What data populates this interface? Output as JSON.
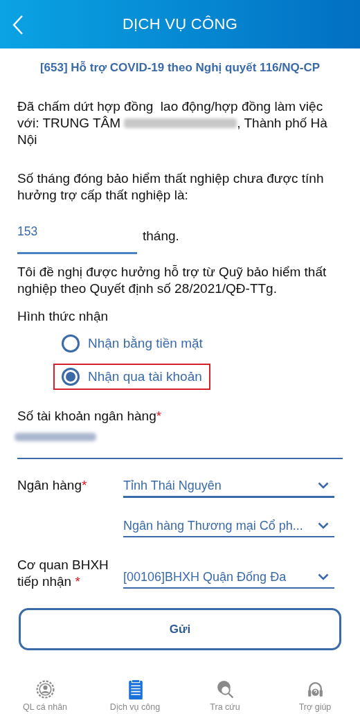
{
  "header": {
    "title": "DỊCH VỤ CÔNG"
  },
  "form_title": "[653] Hỗ trợ COVID-19 theo Nghị quyết 116/NQ-CP",
  "employer_statement": {
    "before": "Đã chấm dứt hợp đồng  lao động/hợp đồng làm việc với: TRUNG TÂM",
    "after": ", Thành phố Hà Nội"
  },
  "months_question": "Số tháng đóng bảo hiểm thất nghiệp chưa được tính hưởng trợ cấp thất nghiệp là:",
  "months_field": {
    "value": "153",
    "unit": "tháng."
  },
  "request_statement": "Tôi đề nghị được hưởng hỗ trợ từ Quỹ bảo hiểm thất nghiệp theo Quyết định số 28/2021/QĐ-TTg.",
  "receive_method": {
    "label": "Hình thức nhận",
    "options": [
      {
        "label": "Nhận bằng tiền mặt",
        "selected": false,
        "highlighted": false
      },
      {
        "label": "Nhận qua tài khoản",
        "selected": true,
        "highlighted": true
      }
    ]
  },
  "account_number": {
    "label": "Số tài khoản ngân hàng",
    "required_mark": "*"
  },
  "bank": {
    "label": "Ngân hàng",
    "required_mark": "*",
    "selects": [
      {
        "value": "Tỉnh Thái Nguyên"
      },
      {
        "value": "Ngân hàng Thương mại Cổ ph..."
      }
    ]
  },
  "agency": {
    "label": "Cơ quan BHXH tiếp nhận",
    "required_mark": "*",
    "value": "[00106]BHXH Quận Đống Đa"
  },
  "submit_button": "Gửi",
  "tab_bar": [
    {
      "label": "QL cá nhân",
      "kind": "person",
      "selected": false
    },
    {
      "label": "Dịch vụ công",
      "kind": "document",
      "selected": true
    },
    {
      "label": "Tra cứu",
      "kind": "lookup",
      "selected": false
    },
    {
      "label": "Trợ giúp",
      "kind": "help",
      "selected": false
    }
  ]
}
